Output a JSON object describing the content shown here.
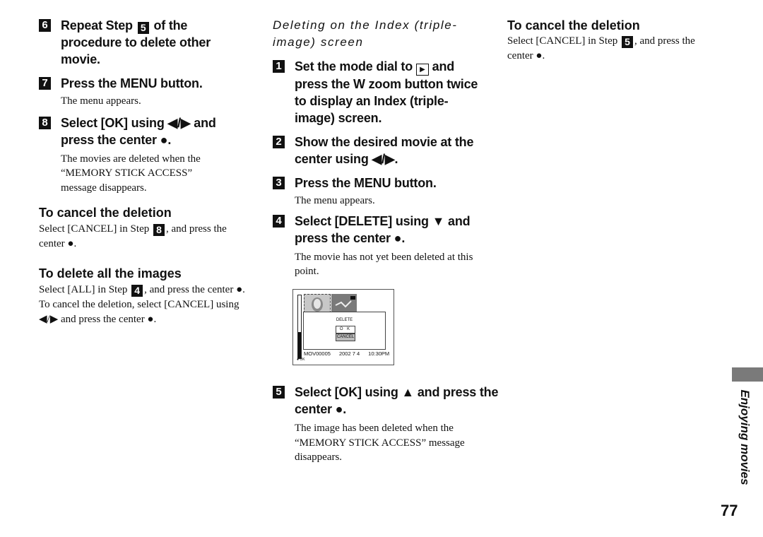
{
  "left_column": {
    "step6": {
      "num": "6",
      "pre": "Repeat Step ",
      "ref": "5",
      "post": " of the procedure to delete other movie."
    },
    "step7": {
      "num": "7",
      "text": "Press the MENU button.",
      "desc": "The menu appears."
    },
    "step8": {
      "num": "8",
      "line1": "Select [OK] using ◀/▶ and",
      "line2": "press the center ●.",
      "desc": "The movies are deleted when the “MEMORY STICK ACCESS” message disappears."
    },
    "cancel": {
      "heading": "To cancel the deletion",
      "pre": "Select [CANCEL] in Step ",
      "ref": "8",
      "post": ", and press the center ●."
    },
    "delete_all": {
      "heading": "To delete all the images",
      "pre": "Select [ALL] in Step ",
      "ref": "4",
      "post": ", and press the center ●. To cancel the deletion, select [CANCEL] using ◀/▶ and press the center ●."
    }
  },
  "middle_column": {
    "section_title": "Deleting on the Index (triple-image) screen",
    "step1": {
      "num": "1",
      "pre": "Set the mode dial to ",
      "icon": "▶",
      "post": " and press the W zoom button twice to display an Index (triple-image) screen."
    },
    "step2": {
      "num": "2",
      "text": "Show the desired movie at the center using ◀/▶."
    },
    "step3": {
      "num": "3",
      "text": "Press the MENU button.",
      "desc": "The menu appears."
    },
    "step4": {
      "num": "4",
      "text": "Select [DELETE] using ▼ and press the center ●.",
      "desc": "The movie has not yet been deleted at this point."
    },
    "screen": {
      "dialog_title": "DELETE",
      "ok_label": "O K",
      "cancel_label": "CANCEL",
      "file_name": "MOV00005",
      "date": "2002  7  4",
      "time": "10:30PM",
      "hint": "● OK"
    },
    "step5": {
      "num": "5",
      "text": "Select [OK] using ▲ and press the center ●.",
      "desc": "The image has been deleted when the “MEMORY STICK ACCESS” message disappears."
    }
  },
  "right_column": {
    "cancel": {
      "heading": "To cancel the deletion",
      "pre": "Select [CANCEL] in Step ",
      "ref": "5",
      "post": ", and press the center ●."
    }
  },
  "side_label": "Enjoying movies",
  "page_number": "77"
}
